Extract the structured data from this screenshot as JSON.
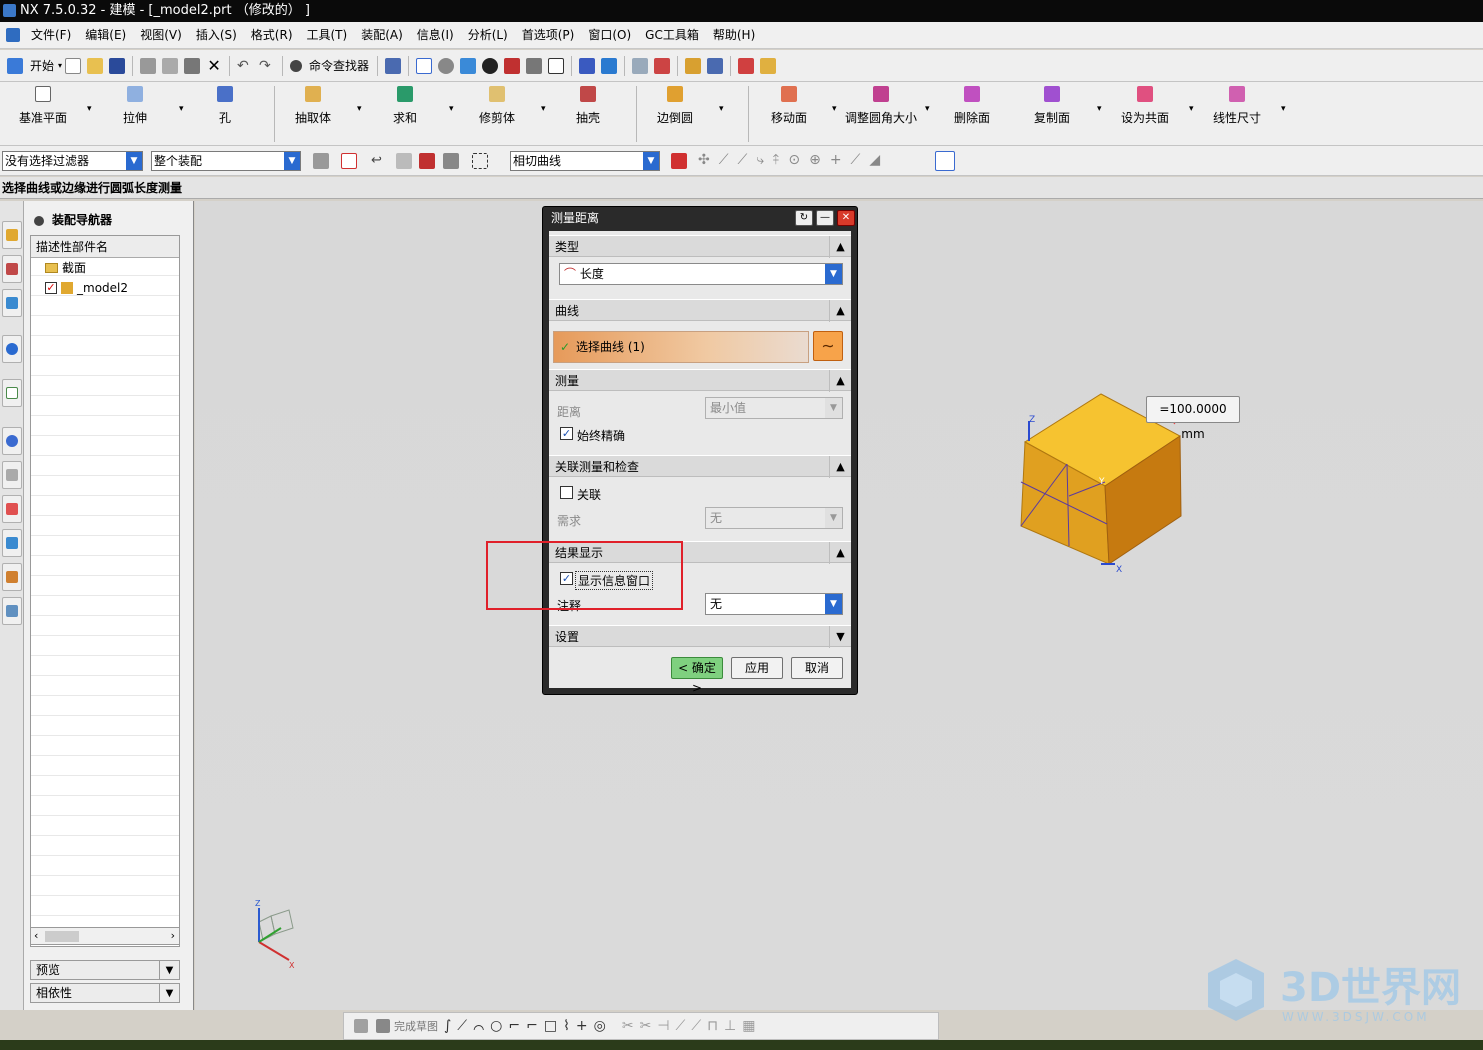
{
  "window": {
    "title": "NX 7.5.0.32 - 建模 - [_model2.prt （修改的） ]"
  },
  "menu": [
    "文件(F)",
    "编辑(E)",
    "视图(V)",
    "插入(S)",
    "格式(R)",
    "工具(T)",
    "装配(A)",
    "信息(I)",
    "分析(L)",
    "首选项(P)",
    "窗口(O)",
    "GC工具箱",
    "帮助(H)"
  ],
  "toolbar1": {
    "start_label": "开始",
    "command_finder_label": "命令查找器"
  },
  "feature_toolbar": [
    "基准平面",
    "拉伸",
    "孔",
    "抽取体",
    "求和",
    "修剪体",
    "抽壳",
    "边倒圆",
    "移动面",
    "调整圆角大小",
    "删除面",
    "复制面",
    "设为共面",
    "线性尺寸"
  ],
  "selection_bar": {
    "filter_value": "没有选择过滤器",
    "scope_value": "整个装配",
    "curve_rule_value": "相切曲线"
  },
  "status_prompt": "选择曲线或边缘进行圆弧长度测量",
  "navigator": {
    "title": "装配导航器",
    "column_header": "描述性部件名",
    "items": [
      {
        "label": "截面"
      },
      {
        "label": "_model2"
      }
    ],
    "preview_label": "预览",
    "dependency_label": "相依性"
  },
  "dialog": {
    "title": "测量距离",
    "type_section": "类型",
    "type_value": "长度",
    "curve_section": "曲线",
    "select_curve": "选择曲线 (1)",
    "measure_section": "测量",
    "distance_label": "距离",
    "distance_value": "最小值",
    "always_accurate": "始终精确",
    "assoc_section": "关联测量和检查",
    "assoc_label": "关联",
    "need_label": "需求",
    "need_value": "无",
    "result_section": "结果显示",
    "show_info_window": "显示信息窗口",
    "annotation_label": "注释",
    "annotation_value": "无",
    "settings_section": "设置",
    "ok_label": "< 确定 >",
    "apply_label": "应用",
    "cancel_label": "取消"
  },
  "viewport": {
    "measure_result": "=100.0000 mm",
    "axis_z": "Z",
    "axis_y": "Y",
    "axis_x": "X"
  },
  "sketch_toolbar": {
    "finish_sketch": "完成草图"
  },
  "watermark": {
    "brand": "3D世界网",
    "url": "WWW.3DSJW.COM"
  }
}
